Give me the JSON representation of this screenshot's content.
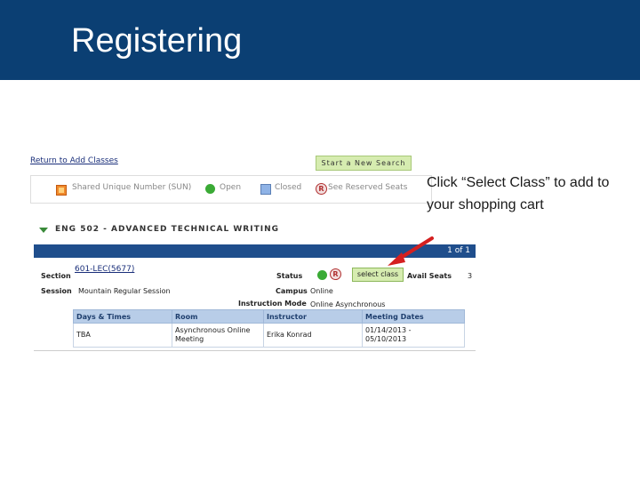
{
  "slide": {
    "title": "Registering",
    "callout": "Click “Select Class” to add to your shopping cart"
  },
  "screenshot": {
    "return_link": "Return to Add Classes",
    "new_search_button": "Start a New Search",
    "legend": {
      "sun": "Shared Unique Number (SUN)",
      "open": "Open",
      "closed": "Closed",
      "reserved": "See Reserved Seats"
    },
    "course_title": "ENG  502 - ADVANCED TECHNICAL WRITING",
    "pager": "1 of 1",
    "section_label": "Section",
    "section_value": "601-LEC(5677)",
    "status_label": "Status",
    "select_button": "select class",
    "avail_seats_label": "Avail Seats",
    "avail_seats_value": "3",
    "session_label": "Session",
    "session_value": "Mountain Regular Session",
    "campus_label": "Campus",
    "campus_value": "Online",
    "instruction_mode_label": "Instruction Mode",
    "instruction_mode_value": "Online Asynchronous",
    "table": {
      "headers": [
        "Days & Times",
        "Room",
        "Instructor",
        "Meeting Dates"
      ],
      "row": [
        "TBA",
        "Asynchronous Online\nMeeting",
        "Erika Konrad",
        "01/14/2013 -\n05/10/2013"
      ]
    },
    "status_icons": [
      "open-dot-icon",
      "reserved-r-icon"
    ],
    "colors": {
      "banner": "#0b3f73",
      "header_bar": "#1f4e8c",
      "button_bg": "#d6ecb0",
      "arrow": "#d42020"
    }
  }
}
